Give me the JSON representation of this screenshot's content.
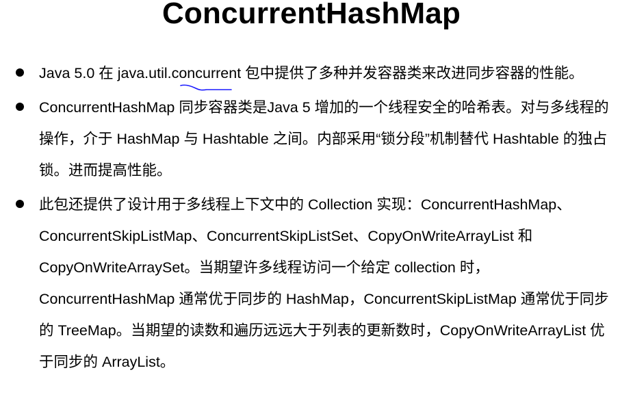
{
  "title": "ConcurrentHashMap",
  "bullets": [
    {
      "text": "Java 5.0 在 java.util.concurrent 包中提供了多种并发容器类来改进同步容器的性能。"
    },
    {
      "text": "ConcurrentHashMap 同步容器类是Java 5 增加的一个线程安全的哈希表。对与多线程的操作，介于 HashMap 与 Hashtable 之间。内部采用“锁分段”机制替代 Hashtable 的独占锁。进而提高性能。"
    },
    {
      "text": "此包还提供了设计用于多线程上下文中的 Collection 实现：ConcurrentHashMap、ConcurrentSkipListMap、ConcurrentSkipListSet、CopyOnWriteArrayList 和 CopyOnWriteArraySet。当期望许多线程访问一个给定 collection 时，ConcurrentHashMap 通常优于同步的 HashMap，ConcurrentSkipListMap 通常优于同步的 TreeMap。当期望的读数和遍历远远大于列表的更新数时，CopyOnWriteArrayList 优于同步的 ArrayList。"
    }
  ],
  "colors": {
    "text": "#000000",
    "background": "#ffffff",
    "annotation": "#1a1aff"
  }
}
